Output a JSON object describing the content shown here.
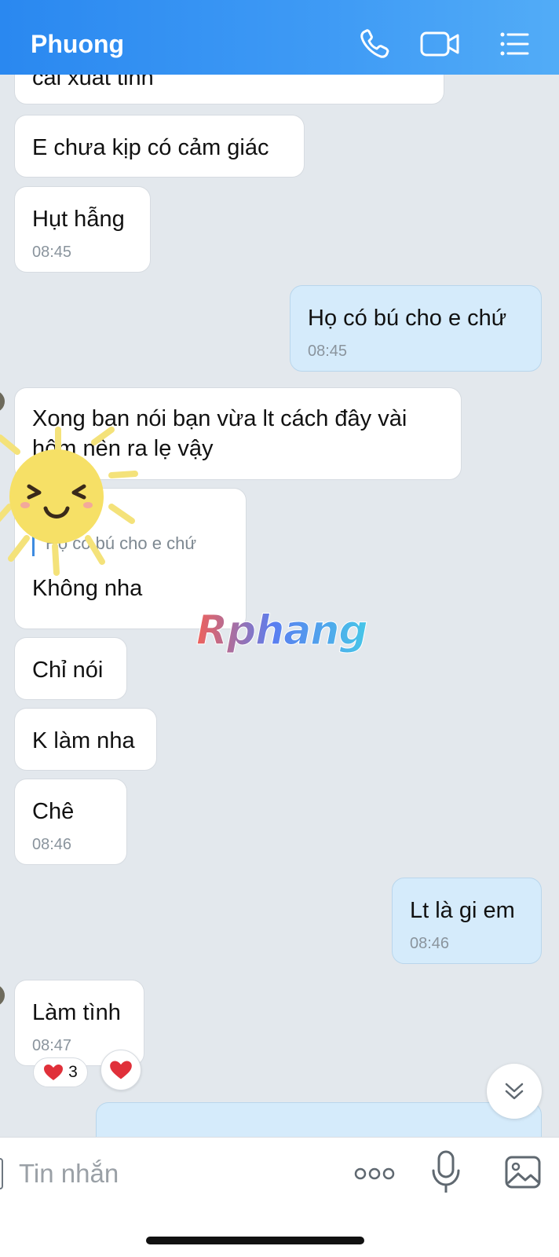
{
  "header": {
    "contact_name": "Phuong",
    "phone_icon": "phone-icon",
    "video_icon": "video-call-icon",
    "menu_icon": "list-menu-icon"
  },
  "messages": [
    {
      "dir": "in",
      "text": "cái xuất tinh"
    },
    {
      "dir": "in",
      "text": "E chưa kịp có cảm giác"
    },
    {
      "dir": "in",
      "text": "Hụt hẫng",
      "time": "08:45"
    },
    {
      "dir": "out",
      "text": "Họ có bú cho e chứ",
      "time": "08:45"
    },
    {
      "dir": "in",
      "text": "Xong bạn nói bạn vừa lt cách đây vài hôm nên ra lẹ vậy"
    },
    {
      "dir": "in",
      "quote": "Họ có bú cho e chứ",
      "text": "Không nha"
    },
    {
      "dir": "in",
      "text": "Chỉ nói"
    },
    {
      "dir": "in",
      "text": "K làm nha"
    },
    {
      "dir": "in",
      "text": "Chê",
      "time": "08:46"
    },
    {
      "dir": "out",
      "text": "Lt là gi em",
      "time": "08:46"
    },
    {
      "dir": "in",
      "text": "Làm tình",
      "time": "08:47",
      "reaction_count": "3"
    }
  ],
  "composer": {
    "placeholder": "Tin nhắn"
  },
  "watermark": "Rphang",
  "colors": {
    "header_start": "#2a88f0",
    "header_end": "#52acf7",
    "chat_bg": "#e3e8ed",
    "outgoing_bubble": "#d5ebfb",
    "incoming_bubble": "#ffffff",
    "heart": "#e0303a"
  }
}
